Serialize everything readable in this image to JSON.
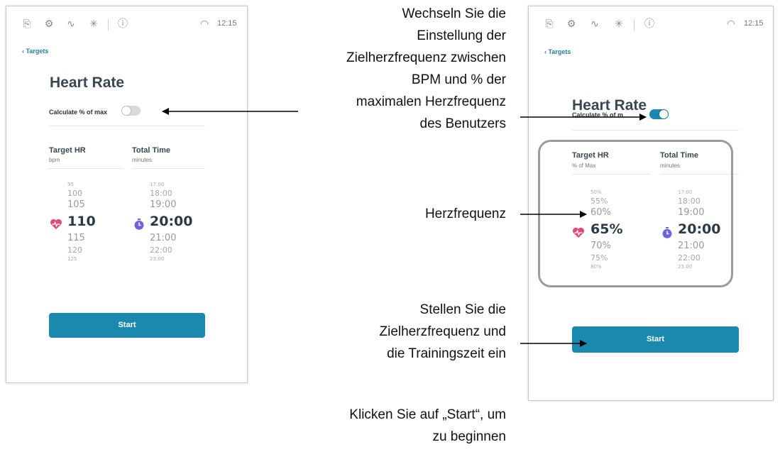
{
  "status": {
    "time": "12:15"
  },
  "left_screen": {
    "back_label": "Targets",
    "title": "Heart Rate",
    "calc_label": "Calculate % of max",
    "target_hr": {
      "label": "Target HR",
      "unit": "bpm"
    },
    "total_time": {
      "label": "Total Time",
      "unit": "minutes"
    },
    "hr_values": [
      "95",
      "100",
      "105",
      "110",
      "115",
      "120",
      "125"
    ],
    "time_values": [
      "17:00",
      "18:00",
      "19:00",
      "20:00",
      "21:00",
      "22:00",
      "23:00"
    ],
    "start_label": "Start",
    "toggle_on": false
  },
  "right_screen": {
    "back_label": "Targets",
    "title": "Heart Rate",
    "calc_label": "Calculate % of m",
    "target_hr": {
      "label": "Target HR",
      "unit": "% of Max"
    },
    "total_time": {
      "label": "Total Time",
      "unit": "minutes"
    },
    "hr_values": [
      "50%",
      "55%",
      "60%",
      "65%",
      "70%",
      "75%",
      "80%"
    ],
    "time_values": [
      "17:00",
      "18:00",
      "19:00",
      "20:00",
      "21:00",
      "22:00",
      "23:00"
    ],
    "start_label": "Start",
    "toggle_on": true
  },
  "annotations": {
    "toggle_text": [
      "Wechseln Sie die",
      "Einstellung der",
      "Zielherzfrequenz zwischen",
      "BPM und % der",
      "maximalen Herzfrequenz",
      "des Benutzers"
    ],
    "hr_text": [
      "Herzfrequenz"
    ],
    "set_text": [
      "Stellen Sie die",
      "Zielherzfrequenz und",
      "die Trainingszeit ein"
    ],
    "start_text": [
      "Klicken Sie auf „Start“, um",
      "zu beginnen"
    ]
  },
  "colors": {
    "accent": "#1b88ae",
    "toggle_off": "#d9d9d9",
    "heart": "#e8457a",
    "timer": "#6d62e0"
  },
  "icons": [
    "exit-icon",
    "gear-icon",
    "pulse-icon",
    "bluetooth-icon",
    "info-icon",
    "wifi-icon",
    "heart-icon",
    "timer-icon",
    "chevron-left-icon"
  ]
}
